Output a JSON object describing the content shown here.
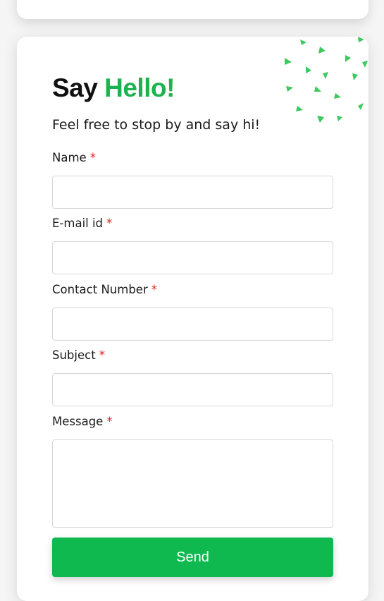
{
  "heading": {
    "prefix": "Say",
    "accent": "Hello!"
  },
  "subtitle": "Feel free to stop by and say hi!",
  "required_mark": "*",
  "fields": {
    "name": {
      "label": "Name",
      "value": "",
      "placeholder": ""
    },
    "email": {
      "label": "E-mail id",
      "value": "",
      "placeholder": ""
    },
    "contact": {
      "label": "Contact Number",
      "value": "",
      "placeholder": ""
    },
    "subject": {
      "label": "Subject",
      "value": "",
      "placeholder": ""
    },
    "message": {
      "label": "Message",
      "value": "",
      "placeholder": ""
    }
  },
  "send_label": "Send",
  "colors": {
    "accent": "#1cb34f",
    "button": "#0fb94f",
    "required": "#e0261c",
    "confetti": "#3cc95f"
  },
  "decoration_icon": "confetti-triangles-icon"
}
